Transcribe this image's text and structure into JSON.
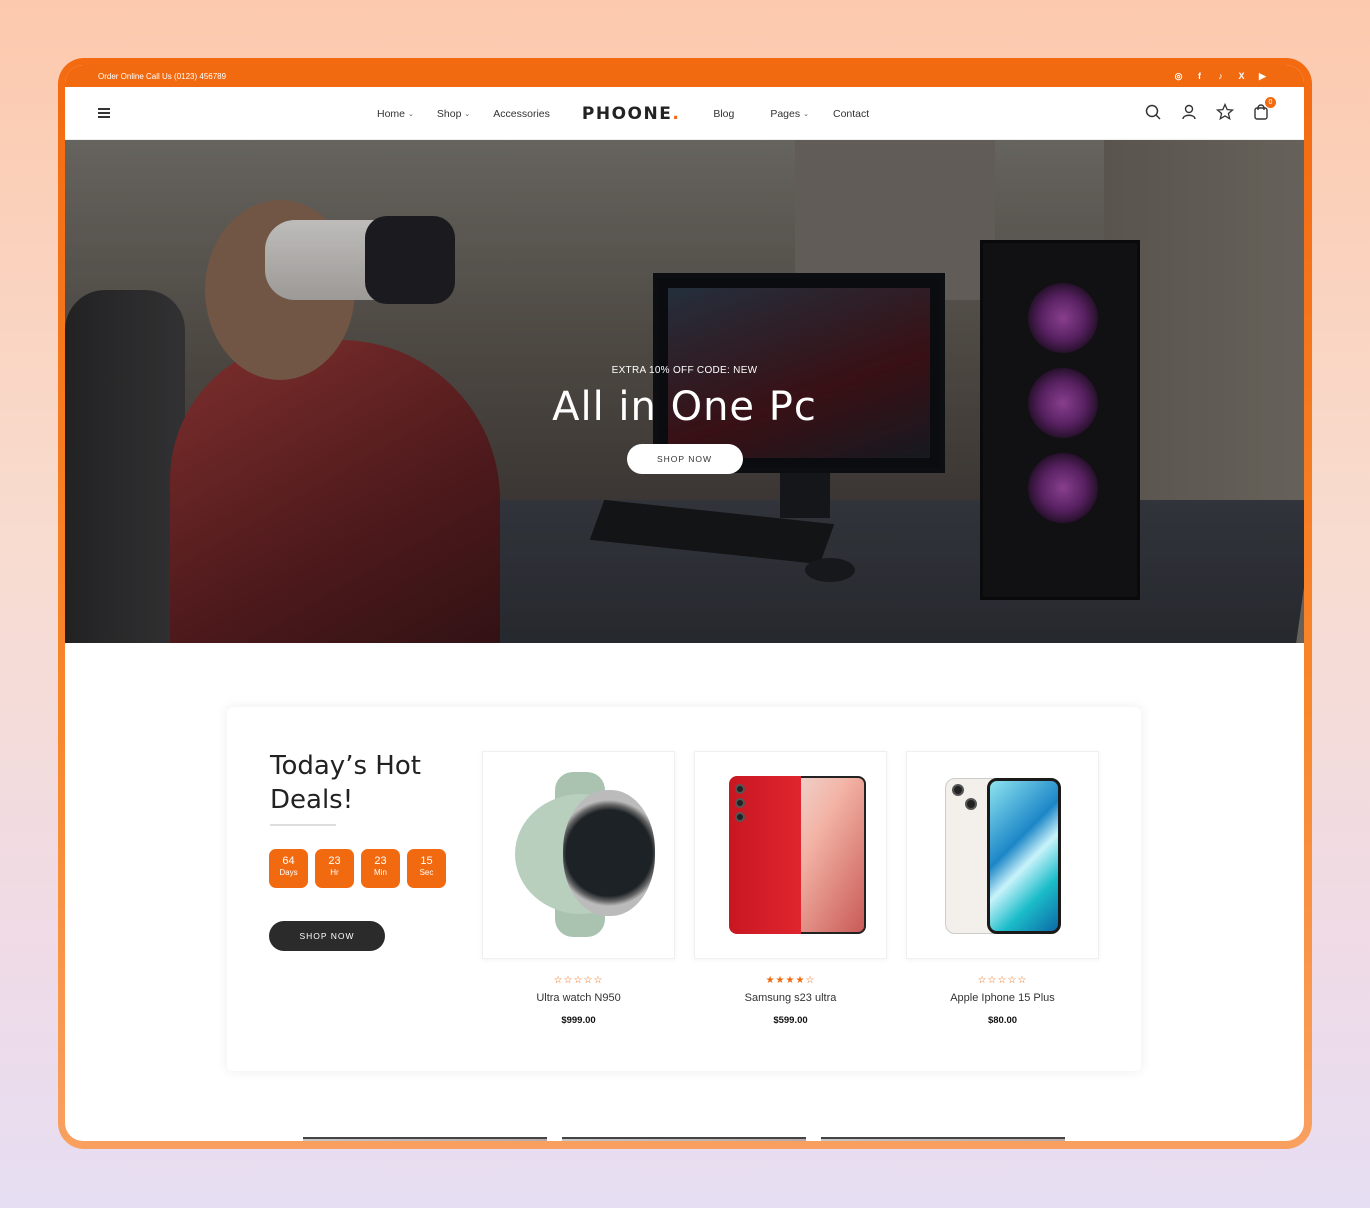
{
  "topbar": {
    "call_text": "Order Online Call Us (0123) 456789",
    "socials": [
      {
        "icon": "instagram-icon",
        "glyph": "◎"
      },
      {
        "icon": "facebook-icon",
        "glyph": "f"
      },
      {
        "icon": "tiktok-icon",
        "glyph": "♪"
      },
      {
        "icon": "x-icon",
        "glyph": "X"
      },
      {
        "icon": "youtube-icon",
        "glyph": "▶"
      }
    ]
  },
  "nav": {
    "items": [
      {
        "label": "Home",
        "dropdown": true
      },
      {
        "label": "Shop",
        "dropdown": true
      },
      {
        "label": "Accessories",
        "dropdown": false
      },
      {
        "label": "Blog",
        "dropdown": false
      },
      {
        "label": "Pages",
        "dropdown": true
      },
      {
        "label": "Contact",
        "dropdown": false
      }
    ],
    "logo": "PHOONE",
    "logo_dot": ".",
    "cart_count": "0"
  },
  "hero": {
    "eyebrow": "EXTRA 10% OFF CODE: NEW",
    "title": "All in One Pc",
    "button": "SHOP NOW"
  },
  "deals": {
    "title": "Today’s Hot Deals!",
    "countdown": [
      {
        "value": "64",
        "unit": "Days"
      },
      {
        "value": "23",
        "unit": "Hr"
      },
      {
        "value": "23",
        "unit": "Min"
      },
      {
        "value": "15",
        "unit": "Sec"
      }
    ],
    "button": "SHOP NOW",
    "products": [
      {
        "name": "Ultra watch N950",
        "price": "$999.00",
        "rating": 0,
        "stars": "☆☆☆☆☆"
      },
      {
        "name": "Samsung s23 ultra",
        "price": "$599.00",
        "rating": 4,
        "stars": "★★★★☆"
      },
      {
        "name": "Apple Iphone 15 Plus",
        "price": "$80.00",
        "rating": 0,
        "stars": "☆☆☆☆☆"
      }
    ]
  },
  "colors": {
    "accent": "#f26a10",
    "dark_button": "#2b2b2b"
  }
}
